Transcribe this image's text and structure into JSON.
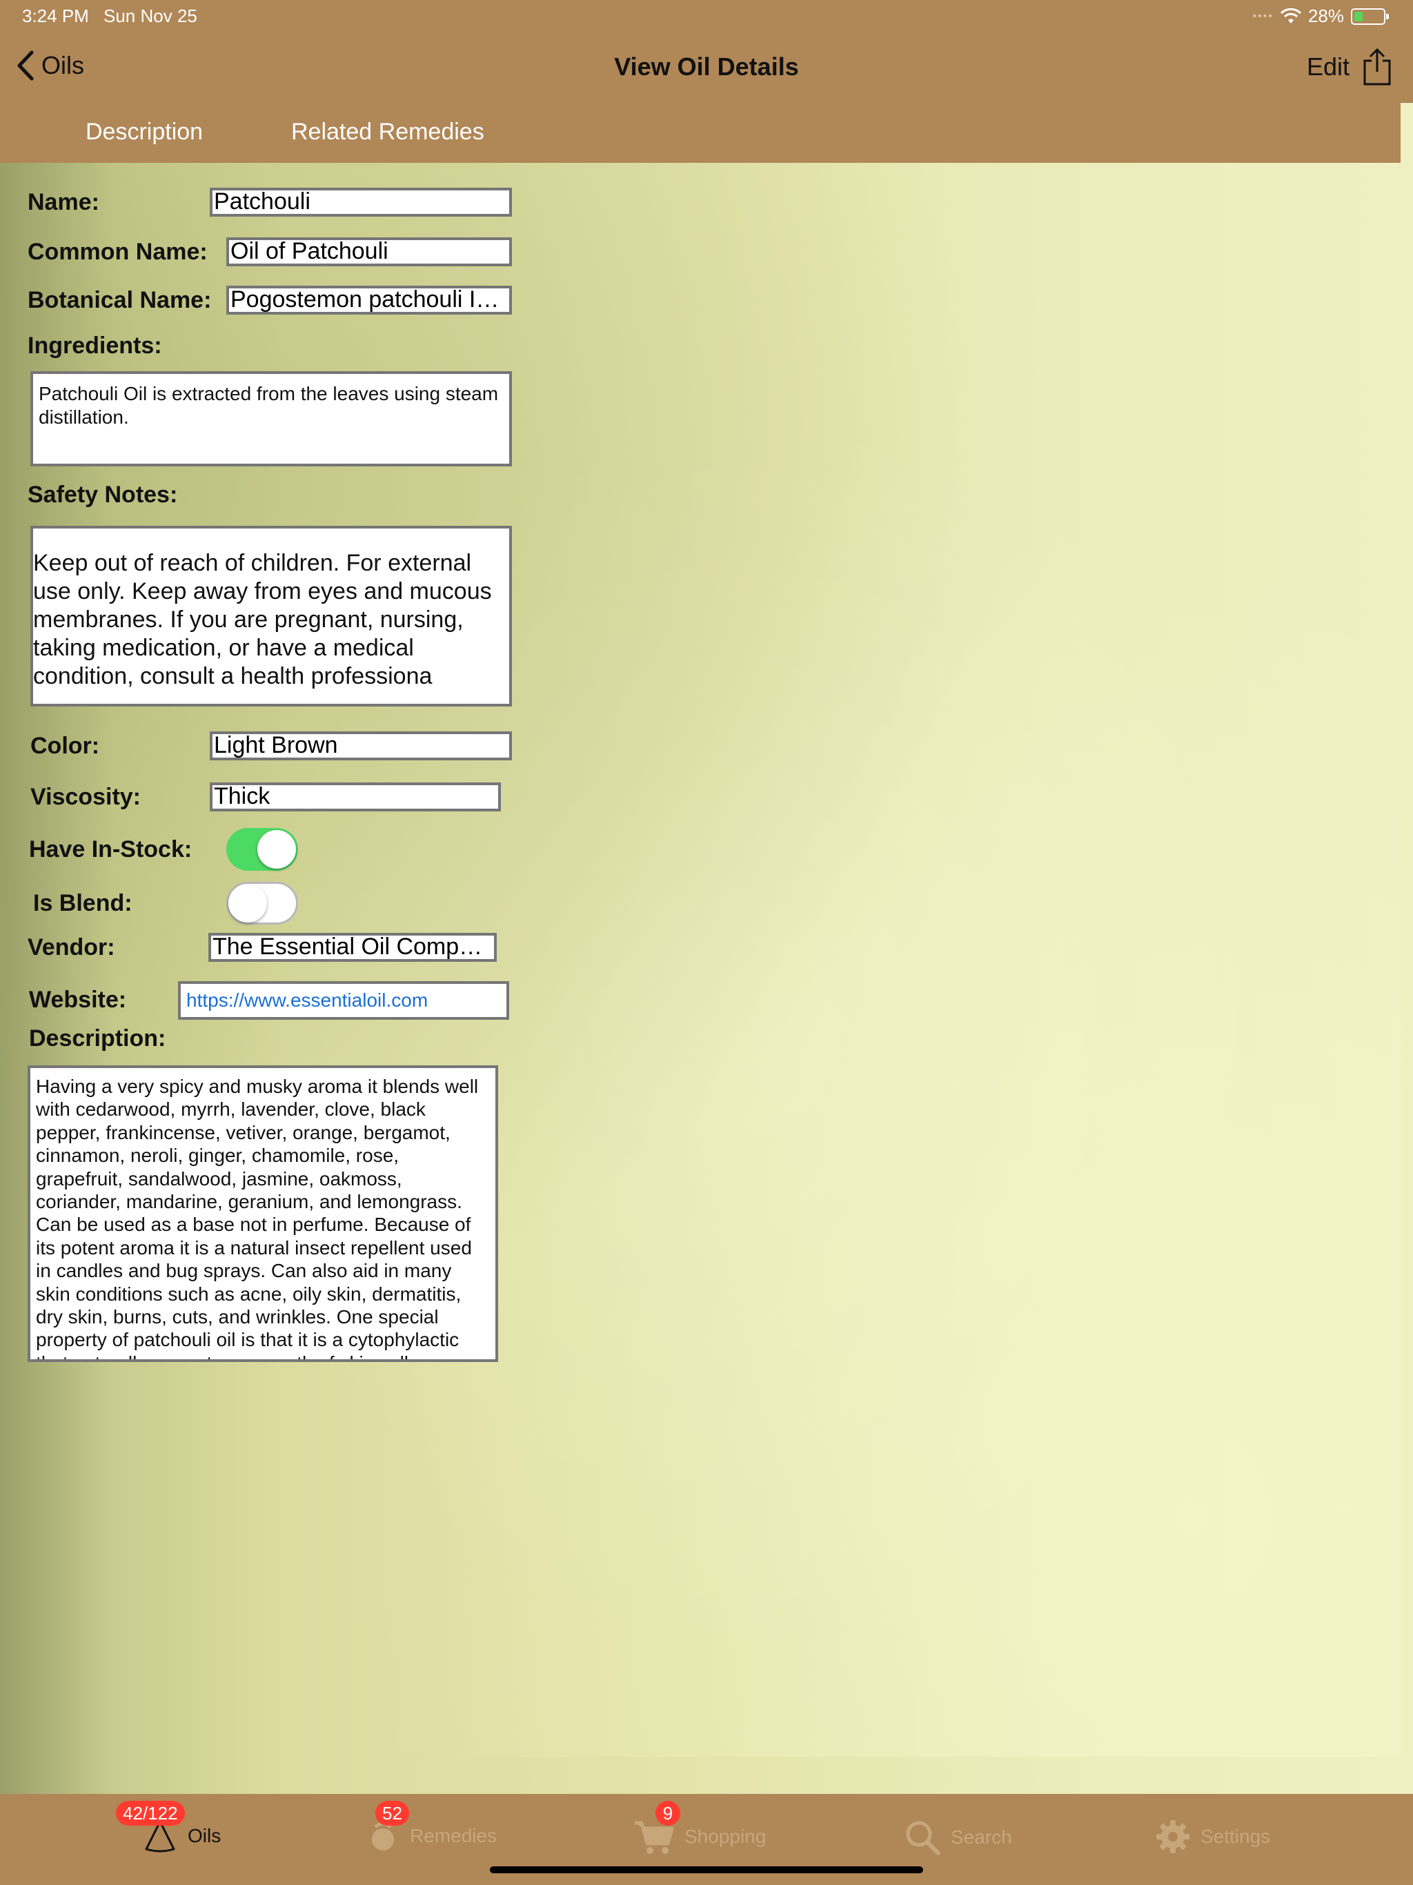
{
  "status_bar": {
    "time": "3:24 PM",
    "date": "Sun Nov 25",
    "battery": "28%"
  },
  "nav": {
    "back_label": "Oils",
    "title": "View Oil Details",
    "edit_label": "Edit"
  },
  "tabs": [
    {
      "label": "Description"
    },
    {
      "label": "Related Remedies"
    }
  ],
  "form": {
    "name_label": "Name:",
    "name_value": "Patchouli",
    "common_name_label": "Common Name:",
    "common_name_value": "Oil of Patchouli",
    "botanical_name_label": "Botanical Name:",
    "botanical_name_value": "Pogostemon patchouli  In...",
    "ingredients_label": "Ingredients:",
    "ingredients_value": "Patchouli Oil is extracted from the leaves using steam distillation.",
    "safety_label": "Safety Notes:",
    "safety_value": "Keep out of reach of children. For external use only. Keep away from eyes and mucous membranes. If you are pregnant, nursing, taking medication, or have a medical condition, consult a health professiona",
    "color_label": "Color:",
    "color_value": "Light Brown",
    "viscosity_label": "Viscosity:",
    "viscosity_value": "Thick",
    "in_stock_label": "Have In-Stock:",
    "in_stock_on": true,
    "is_blend_label": "Is Blend:",
    "is_blend_on": false,
    "vendor_label": "Vendor:",
    "vendor_value": "The Essential Oil Company",
    "website_label": "Website:",
    "website_value": "https://www.essentialoil.com",
    "description_label": "Description:",
    "description_value": "Having a  very spicy and musky aroma it blends well with cedarwood, myrrh, lavender, clove, black pepper, frankincense, vetiver, orange, bergamot, cinnamon, neroli, ginger, chamomile, rose, grapefruit, sandalwood, jasmine, oakmoss, coriander, mandarine, geranium, and lemongrass. Can be used as a base not in perfume.  Because of its potent aroma it is a natural insect repellent used in candles and bug sprays.  Can also aid in many skin conditions such as acne, oily skin, dermatitis, dry skin, burns, cuts, and wrinkles.  One special property of patchouli oil is that it is a cytophylactic that naturally promotes regrowth of skin cells."
  },
  "tab_bar": {
    "items": [
      {
        "label": "Oils",
        "badge": "42/122",
        "icon": "oil-drop-icon"
      },
      {
        "label": "Remedies",
        "badge": "52",
        "icon": "remedies-icon"
      },
      {
        "label": "Shopping",
        "badge": "9",
        "icon": "cart-icon"
      },
      {
        "label": "Search",
        "icon": "search-icon"
      },
      {
        "label": "Settings",
        "icon": "gear-icon"
      }
    ]
  },
  "colors": {
    "bar_brown": "#b08757",
    "toggle_on": "#4cd964",
    "badge_red": "#ff3b30",
    "link_blue": "#1a6fd6"
  }
}
